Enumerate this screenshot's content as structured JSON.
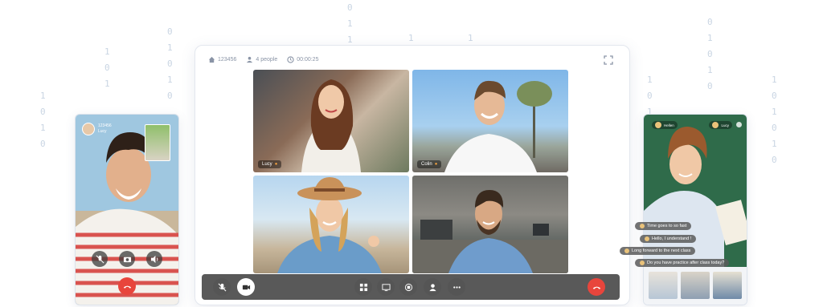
{
  "meeting": {
    "room_id": "123456",
    "participants": "4 people",
    "duration": "00:00:25",
    "icons": {
      "room": "home-icon",
      "people": "person-icon",
      "timer": "clock-icon",
      "fullscreen": "expand-icon"
    }
  },
  "video_tiles": [
    {
      "name": "Lucy"
    },
    {
      "name": "Colin"
    }
  ],
  "left_phone": {
    "caller_line1": "123456",
    "caller_line2": "Lucy"
  },
  "right_phone": {
    "header_label": "Hellen",
    "header_right": "Lucy",
    "chat_messages": [
      "Time goes to so fast",
      "Hello, I understand !",
      "Long forward to the next class",
      "Do you have practice after class today?"
    ]
  },
  "colors": {
    "hangup": "#e8453c",
    "accent_green": "#2f6b4a",
    "digits": "#c9d5e3"
  }
}
